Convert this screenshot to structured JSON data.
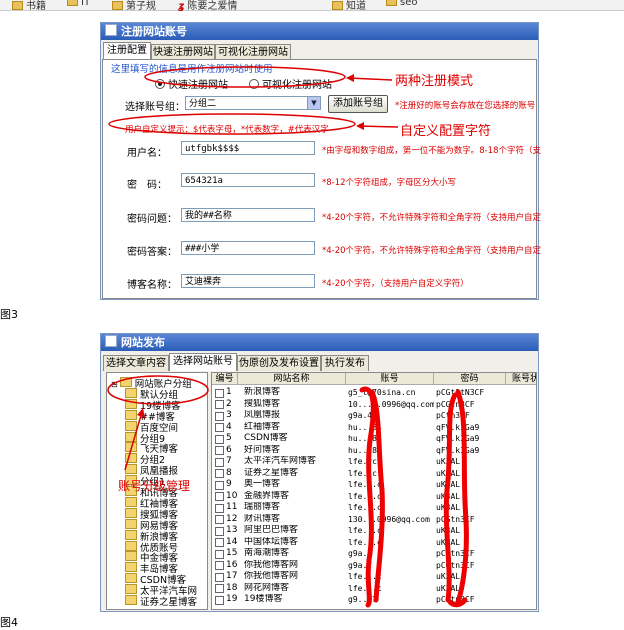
{
  "bookmarks": [
    {
      "label": "书籍",
      "icon": "folder-icon"
    },
    {
      "label": "IT",
      "icon": "folder-icon"
    },
    {
      "label": "第子规",
      "icon": "folder-icon"
    },
    {
      "label": "陈要之爱情",
      "icon": "gift-icon"
    },
    {
      "label": "知道",
      "icon": "folder-icon"
    },
    {
      "label": "seo",
      "icon": "folder-icon"
    }
  ],
  "figures": {
    "fig3": "图3",
    "fig4": "图4"
  },
  "register": {
    "title": "注册网站账号",
    "tabs": [
      "注册配置",
      "快速注册网站",
      "可视化注册网站"
    ],
    "hint": "这里填写的信息是用作注册网站时使用",
    "radio_fast": "快速注册网站",
    "radio_visual": "可视化注册网站",
    "group_label": "选择账号组：",
    "group_value": "分组二",
    "add_group_button": "添加账号组",
    "group_note": "*注册好的账号会存放在您选择的账号",
    "custom_hint": "用户自定义提示：$代表字母，*代表数字，#代表汉字",
    "fields": [
      {
        "label": "用户名：",
        "value": "utfgbk$$$$",
        "note": "*由字母和数字组成，第一位不能为数字。8-18个字符（支"
      },
      {
        "label": "密　码：",
        "value": "654321a",
        "note": "*8-12个字符组成，字母区分大小写"
      },
      {
        "label": "密码问题：",
        "value": "我的##名称",
        "note": "*4-20个字符，不允许特殊字符和全角字符（支持用户自定"
      },
      {
        "label": "密码答案：",
        "value": "###小学",
        "note": "*4-20个字符，不允许特殊字符和全角字符（支持用户自定"
      },
      {
        "label": "博客名称：",
        "value": "艾迪裸奔",
        "note": "*4-20个字符，（支持用户自定义字符）"
      }
    ],
    "anno_modes": "两种注册模式",
    "anno_custom": "自定义配置字符"
  },
  "publish": {
    "title": "网站发布",
    "tabs": [
      "选择文章内容",
      "选择网站账号",
      "伪原创及发布设置",
      "执行发布"
    ],
    "tree": [
      "网站账户分组",
      "默认分组",
      "19楼博客",
      "##博客",
      "百度空间",
      "分组9",
      "飞天博客",
      "分组2",
      "凤凰播报",
      "分组1",
      "和讯博客",
      "红袖博客",
      "搜狐博客",
      "网易博客",
      "新浪博客",
      "优质账号",
      "中金博客",
      "丰岛博客",
      "CSDN博客",
      "太平洋汽车网",
      "证券之星博客"
    ],
    "anno_tree": "账号分级管理",
    "columns": [
      "编号",
      "网站名称",
      "账号",
      "密码",
      "账号状"
    ],
    "rows": [
      [
        "1",
        "新浪博客",
        "g5_t@70sina.cn",
        "pCGt3tN3CF"
      ],
      [
        "2",
        "搜狐博客",
        "10.....0996@qq.com",
        "pCGtn3CF"
      ],
      [
        "3",
        "凤凰博报",
        "g9a.4",
        "pCtn3CF"
      ],
      [
        "4",
        "红袖博客",
        "hu...84",
        "qFV.kIGa9"
      ],
      [
        "5",
        "CSDN博客",
        "hu...84",
        "qFV.kIGa9"
      ],
      [
        "6",
        "好问博客",
        "hu...84",
        "qFV.kIGa9"
      ],
      [
        "7",
        "太平洋汽车网博客",
        "lfe.rc",
        "uK3AL"
      ],
      [
        "8",
        "证券之星博客",
        "lfe..c",
        "uK3AL"
      ],
      [
        "9",
        "奥一博客",
        "lfe...c",
        "uK3AL"
      ],
      [
        "10",
        "金融界博客",
        "lfe...c",
        "uK3AL"
      ],
      [
        "11",
        "瑞丽博客",
        "lfe...c",
        "uK3AL"
      ],
      [
        "12",
        "财讯博客",
        "130...0996@qq.com",
        "pCGtn3CF"
      ],
      [
        "13",
        "阿里巴巴博客",
        "lfe...c",
        "uK3AL"
      ],
      [
        "14",
        "中国体坛博客",
        "lfe...c",
        "uK3AL"
      ],
      [
        "15",
        "南海潮博客",
        "g9a.7",
        "pCGtn3CF"
      ],
      [
        "16",
        "你我他博客网",
        "g9a.7",
        "pCGtn3CF"
      ],
      [
        "17",
        "你我他博客网",
        "lfe...c",
        "uK3AL"
      ],
      [
        "18",
        "网花网博客",
        "lfe...c",
        "uK3AL"
      ],
      [
        "19",
        "19楼博客",
        "g9...7",
        "pCGtn3CF"
      ]
    ]
  },
  "colors": {
    "title_bar": "#3a6cc6",
    "annotation_red": "#dd0000"
  }
}
